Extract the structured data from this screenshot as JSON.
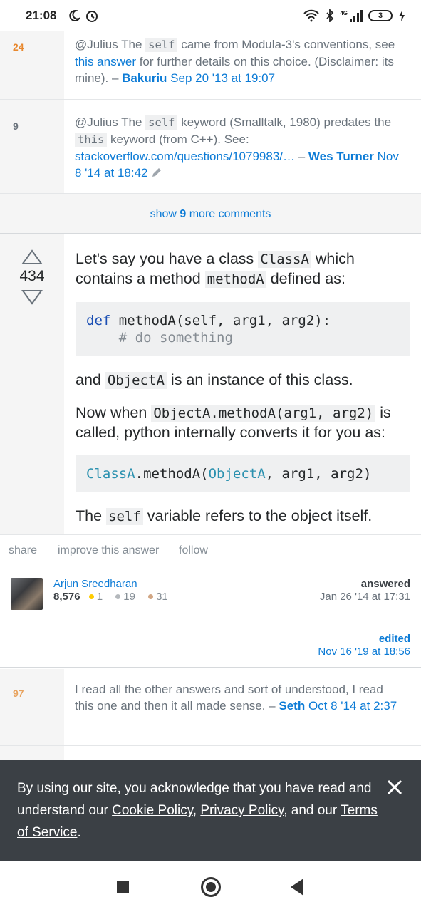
{
  "status_bar": {
    "time": "21:08",
    "network": "4G",
    "battery": "3"
  },
  "comments_top": [
    {
      "score": "24",
      "pre": "@Julius The ",
      "code": "self",
      "mid": " came from Modula-3's conventions, see ",
      "link": "this answer",
      "post": " for further details on this choice. (Disclaimer: its mine). – ",
      "user": "Bakuriu",
      "date": "Sep 20 '13 at 19:07"
    },
    {
      "score": "9",
      "pre": "@Julius The ",
      "code": "self",
      "mid": " keyword (Smalltalk, 1980) predates the ",
      "code2": "this",
      "mid2": " keyword (from C++). See: ",
      "link": "stackoverflow.com/questions/1079983/…",
      "sep": " – ",
      "user": "Wes Turner",
      "date": "Nov 8 '14 at 18:42"
    }
  ],
  "show_more": {
    "pre": "show ",
    "count": "9",
    "post": " more comments"
  },
  "answer": {
    "votes": "434",
    "p1_pre": "Let's say you have a class ",
    "p1_code1": "ClassA",
    "p1_mid": " which contains a method ",
    "p1_code2": "methodA",
    "p1_post": " defined as:",
    "code1_kw": "def",
    "code1_line1": " methodA(self, arg1, arg2):",
    "code1_line2": "    # do something",
    "p2_pre": "and ",
    "p2_code": "ObjectA",
    "p2_post": " is an instance of this class.",
    "p3_pre": "Now when ",
    "p3_code": "ObjectA.methodA(arg1, arg2)",
    "p3_post": " is called, python internally converts it for you as:",
    "code2_cls": "ClassA",
    "code2_mid": ".methodA(",
    "code2_obj": "ObjectA",
    "code2_post": ", arg1, arg2)",
    "p4_pre": "The ",
    "p4_code": "self",
    "p4_post": " variable refers to the object itself."
  },
  "actions": {
    "share": "share",
    "improve": "improve this answer",
    "follow": "follow"
  },
  "author": {
    "name": "Arjun Sreedharan",
    "rep": "8,576",
    "gold": "1",
    "silver": "19",
    "bronze": "31",
    "label": "answered",
    "time": "Jan 26 '14 at 17:31"
  },
  "edit": {
    "label": "edited",
    "time": "Nov 16 '19 at 18:56"
  },
  "comment_bottom": {
    "score": "97",
    "text": "I read all the other answers and sort of understood, I read this one and then it all made sense. – ",
    "user": "Seth",
    "date": "Oct 8 '14 at 2:37"
  },
  "cookie": {
    "pre": "By using our site, you acknowledge that you have read and understand our ",
    "cookie_policy": "Cookie Policy",
    "sep1": ", ",
    "privacy_policy": "Privacy Policy",
    "sep2": ", and our ",
    "terms": "Terms of Service",
    "end": "."
  },
  "colors": {
    "link": "#0c7bd6",
    "score_orange": "#e8882e",
    "banner": "#3b4045",
    "gold": "#ffcc01",
    "silver": "#b4b8bc",
    "bronze": "#d1a684"
  }
}
